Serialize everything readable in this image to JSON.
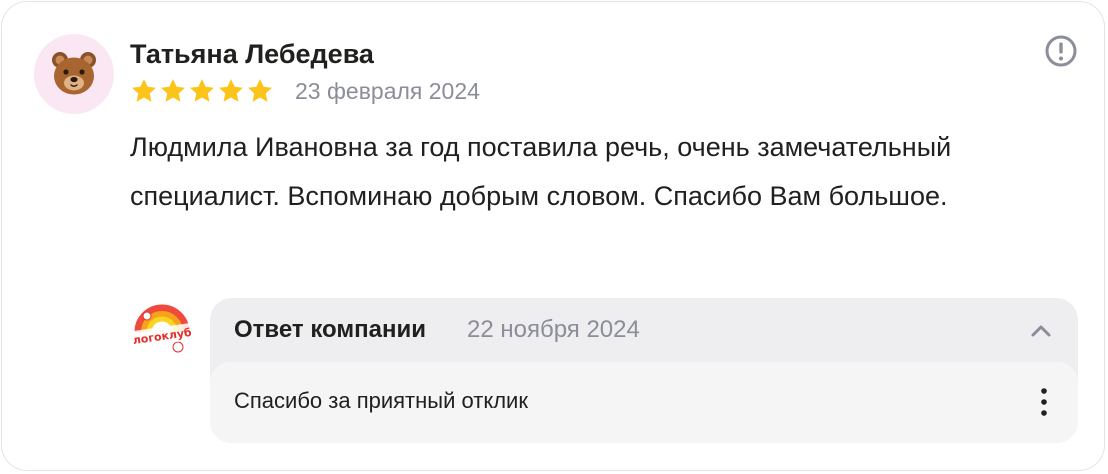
{
  "review": {
    "author_name": "Татьяна Лебедева",
    "avatar_icon": "bear-face-icon",
    "rating": 5,
    "rating_max": 5,
    "date": "23 февраля 2024",
    "text": "Людмила Ивановна за год поставила речь, очень замечательный специалист. Вспоминаю добрым словом. Спасибо Вам большое.",
    "report_icon": "exclamation-circle-icon"
  },
  "reply": {
    "company_logo_text": "логоклуб",
    "title": "Ответ компании",
    "date": "22 ноября 2024",
    "collapse_icon": "chevron-up-icon",
    "text": "Спасибо за приятный отклик",
    "more_icon": "vertical-dots-icon"
  },
  "colors": {
    "star": "#fcc419",
    "text": "#21201f",
    "muted": "#8b8d98",
    "avatar_bg": "#fbe6f3",
    "reply_bg": "#eeeef0"
  }
}
